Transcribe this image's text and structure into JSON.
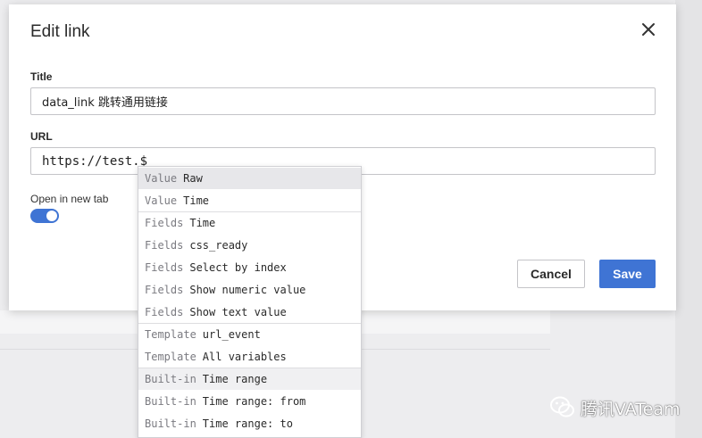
{
  "dialog": {
    "title": "Edit link",
    "close_icon": "close-icon",
    "fields": {
      "title_label": "Title",
      "title_value": "data_link 跳转通用链接",
      "url_label": "URL",
      "url_value": "https://test.$",
      "new_tab_label": "Open in new tab",
      "new_tab_enabled": true
    },
    "buttons": {
      "cancel": "Cancel",
      "save": "Save"
    },
    "colors": {
      "primary": "#3f74d4"
    }
  },
  "suggestions": [
    {
      "group": "Value",
      "label": "Raw",
      "state": "selected"
    },
    {
      "group": "Value",
      "label": "Time"
    },
    {
      "group": "Fields",
      "label": "Time"
    },
    {
      "group": "Fields",
      "label": "css_ready"
    },
    {
      "group": "Fields",
      "label": "Select by index"
    },
    {
      "group": "Fields",
      "label": "Show numeric value"
    },
    {
      "group": "Fields",
      "label": "Show text value"
    },
    {
      "group": "Template",
      "label": "url_event"
    },
    {
      "group": "Template",
      "label": "All variables"
    },
    {
      "group": "Built-in",
      "label": "Time range",
      "state": "hover"
    },
    {
      "group": "Built-in",
      "label": "Time range: from"
    },
    {
      "group": "Built-in",
      "label": "Time range: to"
    }
  ],
  "watermark": {
    "text": "腾讯VATeam",
    "icon": "wechat-icon"
  }
}
